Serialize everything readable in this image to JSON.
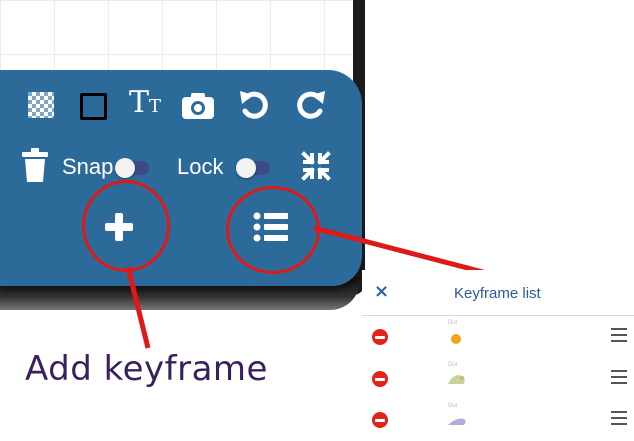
{
  "toolbar": {
    "snap_label": "Snap",
    "lock_label": "Lock",
    "text_icon_glyph_big": "T",
    "text_icon_glyph_small": "T",
    "snap_on": false,
    "lock_on": false
  },
  "actions": {
    "add_keyframe_glyph": "+"
  },
  "annotation": {
    "caption": "Add keyframe",
    "color": "#e01818"
  },
  "keyframe_list": {
    "close_glyph": "×",
    "title": "Keyframe list",
    "rows": [
      {
        "thumb_label": "Dur",
        "thumb_color": "#f2a21b"
      },
      {
        "thumb_label": "Dur",
        "thumb_color": "#c8d39a"
      },
      {
        "thumb_label": "Dur",
        "thumb_color": "#b9a9d8"
      }
    ]
  },
  "colors": {
    "panel": "#2c6b99",
    "annotation_red": "#e01818",
    "delete_red": "#e2231a",
    "caption_text": "#3a1f5f"
  }
}
